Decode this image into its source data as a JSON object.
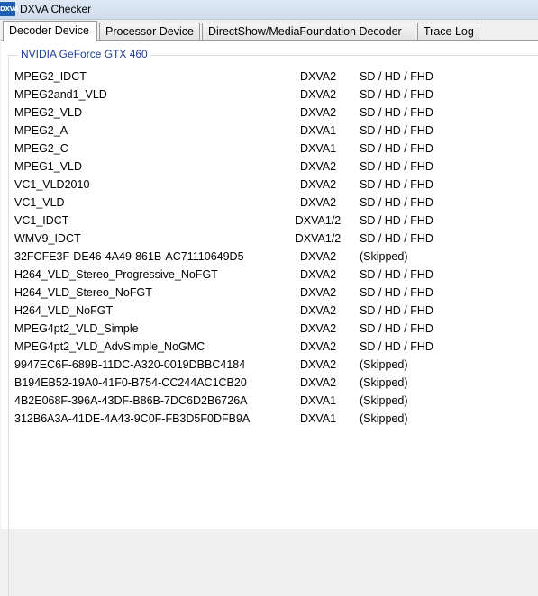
{
  "window": {
    "icon_text": "DXVA",
    "title": "DXVA Checker"
  },
  "tabs": [
    {
      "label": "Decoder Device"
    },
    {
      "label": "Processor Device"
    },
    {
      "label": "DirectShow/MediaFoundation Decoder"
    },
    {
      "label": "Trace Log"
    }
  ],
  "group_title": "NVIDIA GeForce GTX 460",
  "rows": [
    {
      "name": "MPEG2_IDCT",
      "api": "DXVA2",
      "res": "SD / HD / FHD"
    },
    {
      "name": "MPEG2and1_VLD",
      "api": "DXVA2",
      "res": "SD / HD / FHD"
    },
    {
      "name": "MPEG2_VLD",
      "api": "DXVA2",
      "res": "SD / HD / FHD"
    },
    {
      "name": "MPEG2_A",
      "api": "DXVA1",
      "res": "SD / HD / FHD"
    },
    {
      "name": "MPEG2_C",
      "api": "DXVA1",
      "res": "SD / HD / FHD"
    },
    {
      "name": "MPEG1_VLD",
      "api": "DXVA2",
      "res": "SD / HD / FHD"
    },
    {
      "name": "VC1_VLD2010",
      "api": "DXVA2",
      "res": "SD / HD / FHD"
    },
    {
      "name": "VC1_VLD",
      "api": "DXVA2",
      "res": "SD / HD / FHD"
    },
    {
      "name": "VC1_IDCT",
      "api": "DXVA1/2",
      "res": "SD / HD / FHD"
    },
    {
      "name": "WMV9_IDCT",
      "api": "DXVA1/2",
      "res": "SD / HD / FHD"
    },
    {
      "name": "32FCFE3F-DE46-4A49-861B-AC71110649D5",
      "api": "DXVA2",
      "res": "(Skipped)"
    },
    {
      "name": "H264_VLD_Stereo_Progressive_NoFGT",
      "api": "DXVA2",
      "res": "SD / HD / FHD"
    },
    {
      "name": "H264_VLD_Stereo_NoFGT",
      "api": "DXVA2",
      "res": "SD / HD / FHD"
    },
    {
      "name": "H264_VLD_NoFGT",
      "api": "DXVA2",
      "res": "SD / HD / FHD"
    },
    {
      "name": "MPEG4pt2_VLD_Simple",
      "api": "DXVA2",
      "res": "SD / HD / FHD"
    },
    {
      "name": "MPEG4pt2_VLD_AdvSimple_NoGMC",
      "api": "DXVA2",
      "res": "SD / HD / FHD"
    },
    {
      "name": "9947EC6F-689B-11DC-A320-0019DBBC4184",
      "api": "DXVA2",
      "res": "(Skipped)"
    },
    {
      "name": "B194EB52-19A0-41F0-B754-CC244AC1CB20",
      "api": "DXVA2",
      "res": "(Skipped)"
    },
    {
      "name": "4B2E068F-396A-43DF-B86B-7DC6D2B6726A",
      "api": "DXVA1",
      "res": "(Skipped)"
    },
    {
      "name": "312B6A3A-41DE-4A43-9C0F-FB3D5F0DFB9A",
      "api": "DXVA1",
      "res": "(Skipped)"
    }
  ]
}
